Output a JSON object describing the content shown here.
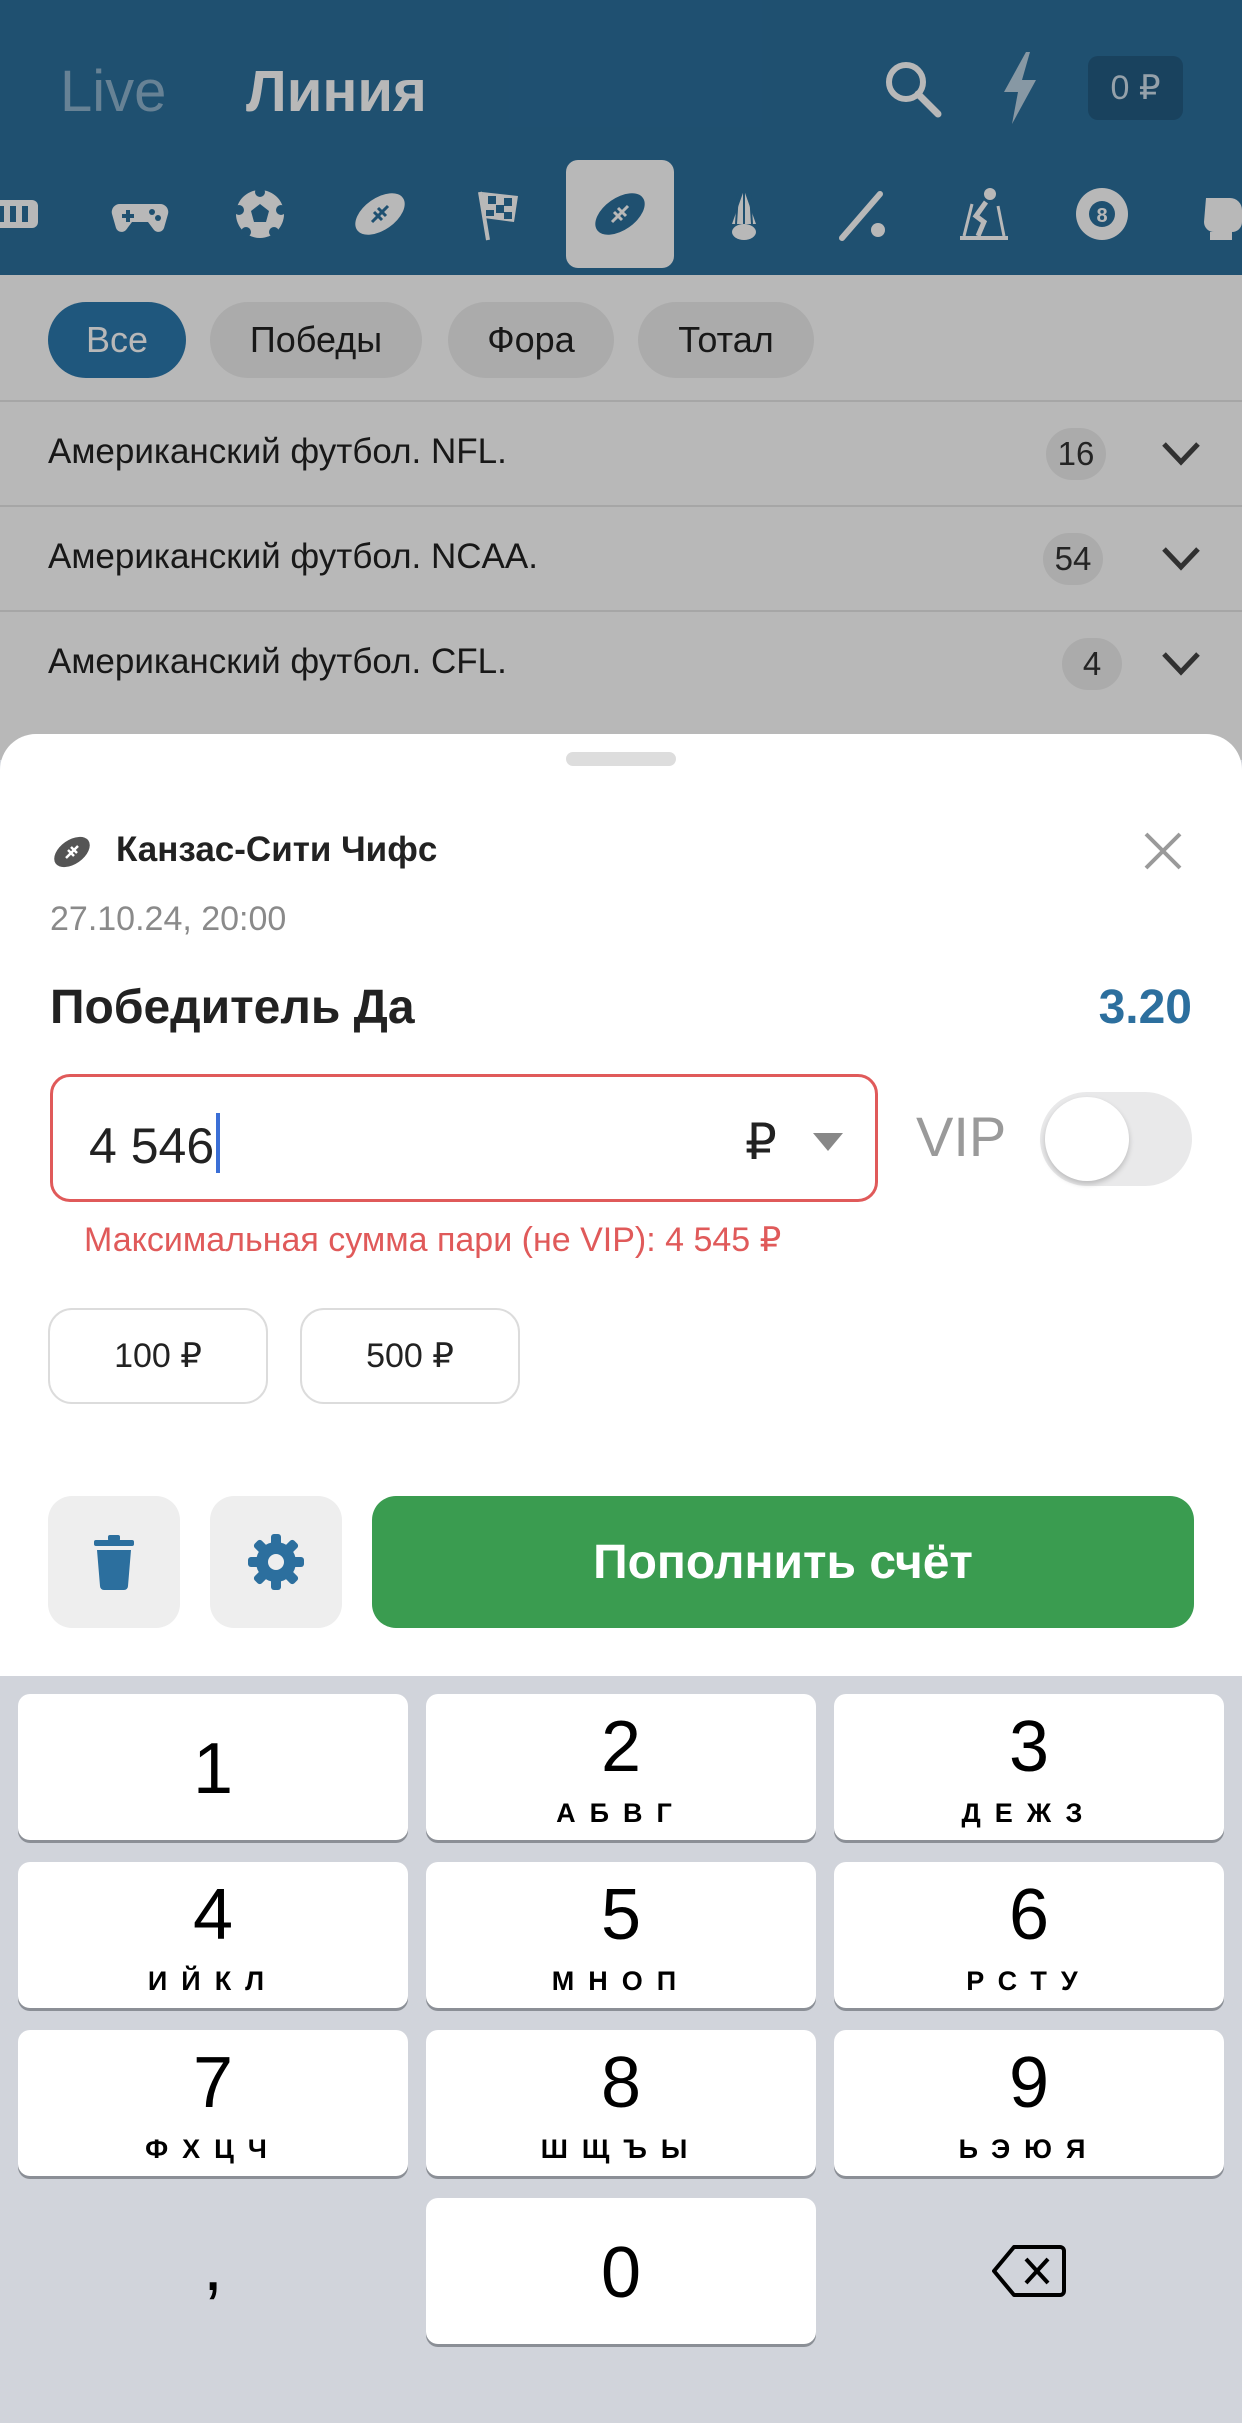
{
  "header": {
    "tab_live": "Live",
    "tab_line": "Линия",
    "balance": "0 ₽",
    "sports_icons": [
      "hockey-icon",
      "esports-icon",
      "soccer-icon",
      "rugby-icon",
      "motorsport-icon",
      "american-football-icon",
      "badminton-icon",
      "baseball-icon",
      "skiing-icon",
      "billiards-icon",
      "boxing-icon"
    ],
    "active_sport": "american-football-icon"
  },
  "filters": [
    "Все",
    "Победы",
    "Фора",
    "Тотал"
  ],
  "leagues": [
    {
      "name": "Американский футбол. NFL.",
      "count": "16"
    },
    {
      "name": "Американский футбол. NCAA.",
      "count": "54"
    },
    {
      "name": "Американский футбол. CFL.",
      "count": "4"
    }
  ],
  "bet_slip": {
    "event_title": "Канзас-Сити Чифс",
    "event_date": "27.10.24, 20:00",
    "outcome": "Победитель Да",
    "odds": "3.20",
    "stake_value": "4 546",
    "currency": "₽",
    "vip_label": "VIP",
    "vip_enabled": false,
    "error": "Максимальная сумма пари (не VIP): 4 545 ₽",
    "quick_amounts": [
      "100 ₽",
      "500 ₽"
    ],
    "deposit_label": "Пополнить счёт"
  },
  "keyboard": {
    "keys": [
      {
        "digit": "1",
        "letters": ""
      },
      {
        "digit": "2",
        "letters": "АБВГ"
      },
      {
        "digit": "3",
        "letters": "ДЕЖЗ"
      },
      {
        "digit": "4",
        "letters": "ИЙКЛ"
      },
      {
        "digit": "5",
        "letters": "МНОП"
      },
      {
        "digit": "6",
        "letters": "РСТУ"
      },
      {
        "digit": "7",
        "letters": "ФХЦЧ"
      },
      {
        "digit": "8",
        "letters": "ШЩЪЫ"
      },
      {
        "digit": "9",
        "letters": "ЬЭЮЯ"
      },
      {
        "digit": "0",
        "letters": ""
      }
    ],
    "comma": ","
  },
  "colors": {
    "header_bg": "#2b6f9c",
    "active_chip": "#2c79ad",
    "odds": "#2c6f9e",
    "error": "#e05a5a",
    "deposit": "#3a9c50"
  }
}
